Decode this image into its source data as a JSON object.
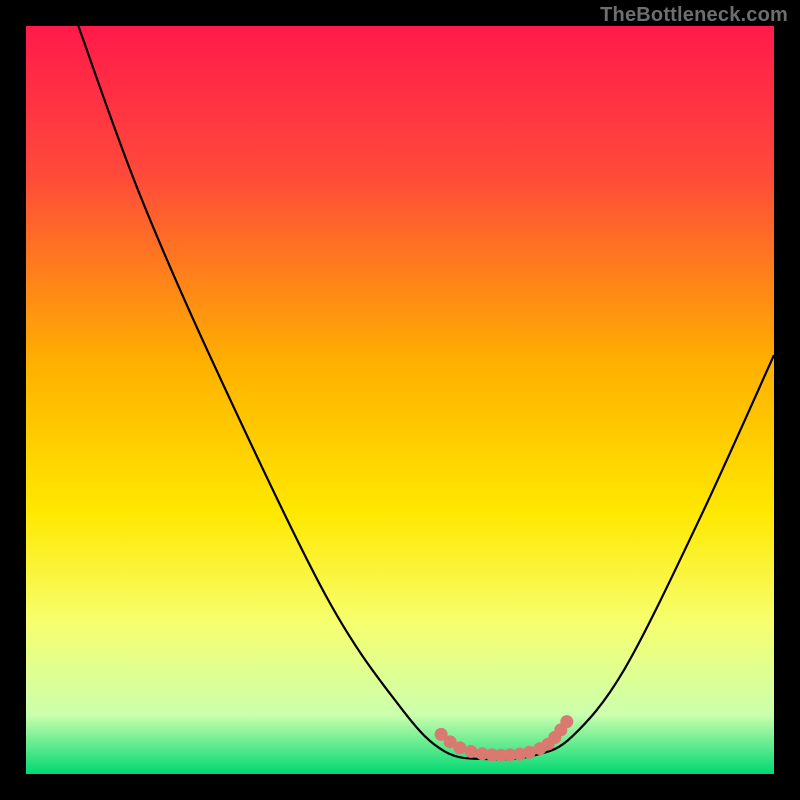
{
  "watermark": "TheBottleneck.com",
  "chart_data": {
    "type": "line",
    "title": "",
    "xlabel": "",
    "ylabel": "",
    "xlim": [
      0,
      100
    ],
    "ylim": [
      0,
      100
    ],
    "gradient_stops": [
      {
        "offset": 0,
        "color": "#ff1a4b"
      },
      {
        "offset": 20,
        "color": "#ff4a3a"
      },
      {
        "offset": 45,
        "color": "#ffb000"
      },
      {
        "offset": 65,
        "color": "#ffe800"
      },
      {
        "offset": 80,
        "color": "#f6ff70"
      },
      {
        "offset": 92,
        "color": "#ccffad"
      },
      {
        "offset": 100,
        "color": "#00d873"
      }
    ],
    "series": [
      {
        "name": "bottleneck-curve",
        "color": "#000000",
        "points": [
          {
            "x": 7,
            "y": 100
          },
          {
            "x": 15,
            "y": 78
          },
          {
            "x": 25,
            "y": 55
          },
          {
            "x": 40,
            "y": 24
          },
          {
            "x": 50,
            "y": 9
          },
          {
            "x": 56,
            "y": 3
          },
          {
            "x": 62,
            "y": 2
          },
          {
            "x": 68,
            "y": 2.5
          },
          {
            "x": 73,
            "y": 5
          },
          {
            "x": 80,
            "y": 14
          },
          {
            "x": 90,
            "y": 34
          },
          {
            "x": 100,
            "y": 56
          }
        ]
      }
    ],
    "markers": {
      "name": "optimal-zone",
      "color": "#d9796f",
      "points": [
        {
          "x": 55.5,
          "y": 5.3
        },
        {
          "x": 56.7,
          "y": 4.3
        },
        {
          "x": 58.0,
          "y": 3.5
        },
        {
          "x": 59.5,
          "y": 3.0
        },
        {
          "x": 61.0,
          "y": 2.7
        },
        {
          "x": 62.3,
          "y": 2.55
        },
        {
          "x": 63.5,
          "y": 2.5
        },
        {
          "x": 64.7,
          "y": 2.55
        },
        {
          "x": 66.0,
          "y": 2.65
        },
        {
          "x": 67.3,
          "y": 2.9
        },
        {
          "x": 68.7,
          "y": 3.4
        },
        {
          "x": 69.8,
          "y": 4.0
        },
        {
          "x": 70.7,
          "y": 4.9
        },
        {
          "x": 71.5,
          "y": 5.9
        },
        {
          "x": 72.3,
          "y": 7.0
        }
      ]
    }
  }
}
